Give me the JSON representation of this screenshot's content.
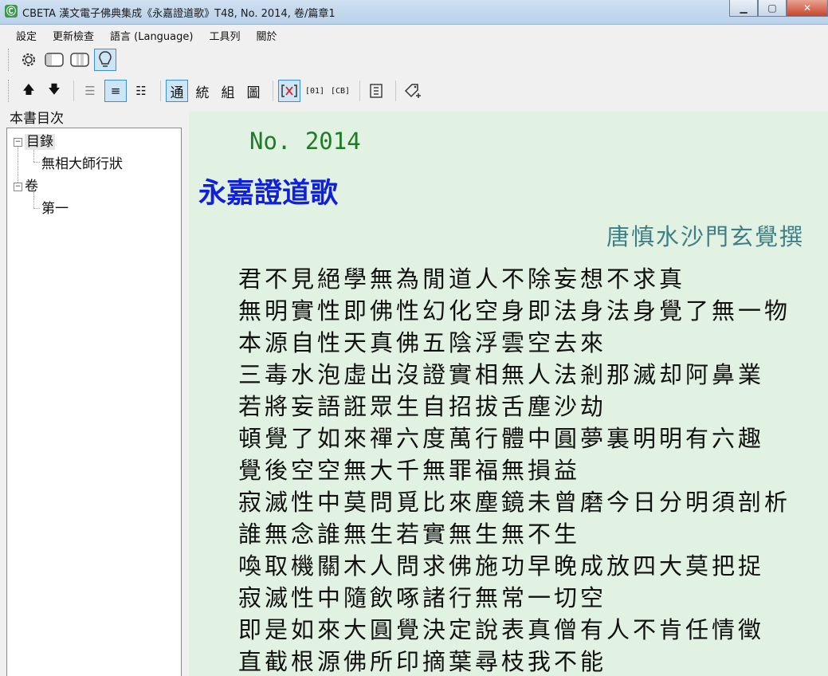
{
  "window": {
    "title": "CBETA 漢文電子佛典集成《永嘉證道歌》T48, No. 2014, 卷/篇章1",
    "app_icon": "Ⓒ"
  },
  "menu": [
    "設定",
    "更新檢查",
    "語言 (Language)",
    "工具列",
    "關於"
  ],
  "toolbar": {
    "mode_buttons": [
      "通",
      "統",
      "組",
      "圖"
    ],
    "cb_labels": [
      "[01]",
      "[CB]"
    ]
  },
  "sidebar": {
    "title": "本書目次",
    "tree": [
      {
        "label": "目錄",
        "children": [
          "無相大師行狀"
        ]
      },
      {
        "label": "卷",
        "children": [
          "第一"
        ]
      }
    ]
  },
  "document": {
    "number": "No. 2014",
    "title": "永嘉證道歌",
    "author": "唐慎水沙門玄覺撰",
    "verses": [
      "君不見絕學無為閒道人不除妄想不求真",
      "無明實性即佛性幻化空身即法身法身覺了無一物",
      "本源自性天真佛五陰浮雲空去來",
      "三毒水泡虛出沒證實相無人法剎那滅却阿鼻業",
      "若將妄語誑眾生自招拔舌塵沙劫",
      "頓覺了如來禪六度萬行體中圓夢裏明明有六趣",
      "覺後空空無大千無罪福無損益",
      "寂滅性中莫問覓比來塵鏡未曾磨今日分明須剖析",
      "誰無念誰無生若實無生無不生",
      "喚取機關木人問求佛施功早晚成放四大莫把捉",
      "寂滅性中隨飲啄諸行無常一切空",
      "即是如來大圓覺決定說表真僧有人不肯任情徵",
      "直截根源佛所印摘葉尋枝我不能"
    ]
  },
  "colors": {
    "content_bg": "#e2f2e2",
    "doc_number": "#1e7b27",
    "doc_title": "#1020d8",
    "doc_author": "#3e7f86"
  }
}
